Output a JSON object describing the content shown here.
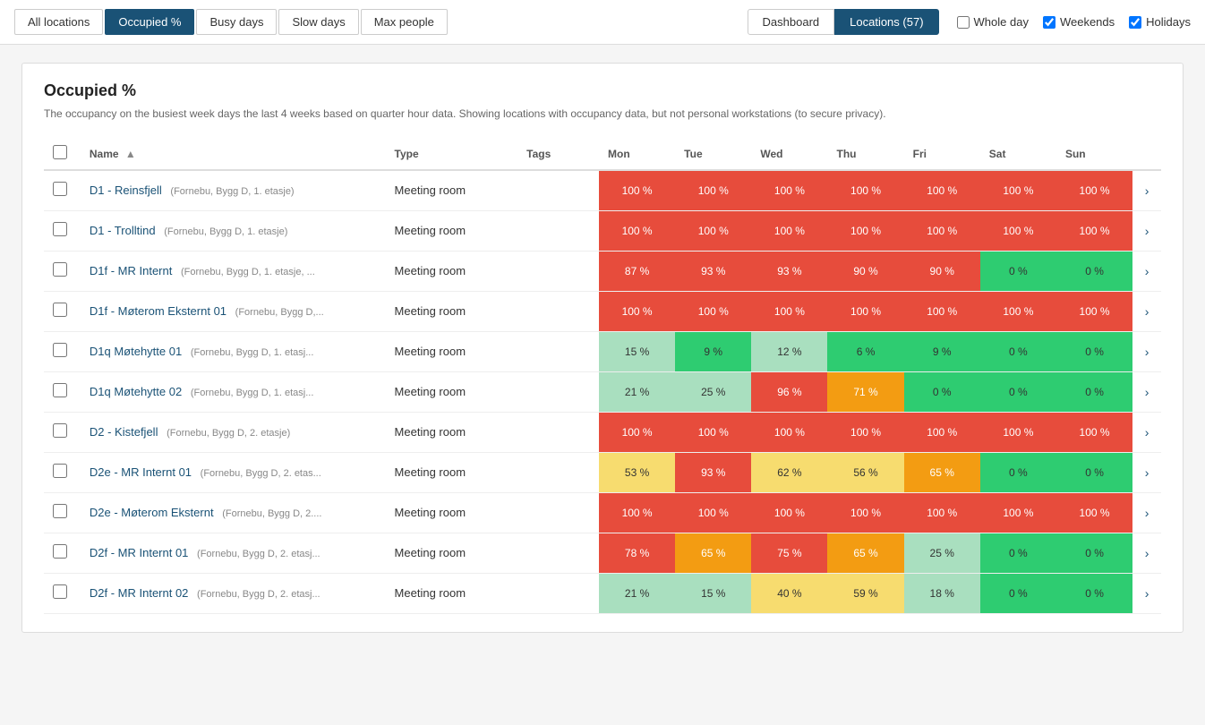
{
  "topbar": {
    "nav_buttons": [
      {
        "label": "All locations",
        "active": false
      },
      {
        "label": "Occupied %",
        "active": true
      },
      {
        "label": "Busy days",
        "active": false
      },
      {
        "label": "Slow days",
        "active": false
      },
      {
        "label": "Max people",
        "active": false
      }
    ],
    "view_buttons": [
      {
        "label": "Dashboard",
        "active": false
      },
      {
        "label": "Locations (57)",
        "active": true
      }
    ],
    "checkboxes": [
      {
        "label": "Whole day",
        "checked": false
      },
      {
        "label": "Weekends",
        "checked": true
      },
      {
        "label": "Holidays",
        "checked": true
      }
    ]
  },
  "card": {
    "title": "Occupied %",
    "subtitle": "The occupancy on the busiest week days the last 4 weeks based on quarter hour data. Showing locations with occupancy data, but not personal workstations (to secure privacy)."
  },
  "table": {
    "headers": [
      "",
      "Name",
      "Type",
      "Tags",
      "Mon",
      "Tue",
      "Wed",
      "Thu",
      "Fri",
      "Sat",
      "Sun",
      ""
    ],
    "rows": [
      {
        "name": "D1 - Reinsfjell",
        "sub": "(Fornebu, Bygg D, 1. etasje)",
        "type": "Meeting room",
        "tags": "",
        "mon": "100 %",
        "tue": "100 %",
        "wed": "100 %",
        "thu": "100 %",
        "fri": "100 %",
        "sat": "100 %",
        "sun": "100 %",
        "mon_c": "c-red",
        "tue_c": "c-red",
        "wed_c": "c-red",
        "thu_c": "c-red",
        "fri_c": "c-red",
        "sat_c": "c-red",
        "sun_c": "c-red"
      },
      {
        "name": "D1 - Trolltind",
        "sub": "(Fornebu, Bygg D, 1. etasje)",
        "type": "Meeting room",
        "tags": "",
        "mon": "100 %",
        "tue": "100 %",
        "wed": "100 %",
        "thu": "100 %",
        "fri": "100 %",
        "sat": "100 %",
        "sun": "100 %",
        "mon_c": "c-red",
        "tue_c": "c-red",
        "wed_c": "c-red",
        "thu_c": "c-red",
        "fri_c": "c-red",
        "sat_c": "c-red",
        "sun_c": "c-red"
      },
      {
        "name": "D1f - MR Internt",
        "sub": "(Fornebu, Bygg D, 1. etasje, ...",
        "type": "Meeting room",
        "tags": "",
        "mon": "87 %",
        "tue": "93 %",
        "wed": "93 %",
        "thu": "90 %",
        "fri": "90 %",
        "sat": "0 %",
        "sun": "0 %",
        "mon_c": "c-red",
        "tue_c": "c-red",
        "wed_c": "c-red",
        "thu_c": "c-red",
        "fri_c": "c-red",
        "sat_c": "c-bright-green",
        "sun_c": "c-bright-green"
      },
      {
        "name": "D1f - Møterom Eksternt 01",
        "sub": "(Fornebu, Bygg D,...",
        "type": "Meeting room",
        "tags": "",
        "mon": "100 %",
        "tue": "100 %",
        "wed": "100 %",
        "thu": "100 %",
        "fri": "100 %",
        "sat": "100 %",
        "sun": "100 %",
        "mon_c": "c-red",
        "tue_c": "c-red",
        "wed_c": "c-red",
        "thu_c": "c-red",
        "fri_c": "c-red",
        "sat_c": "c-red",
        "sun_c": "c-red"
      },
      {
        "name": "D1q Møtehytte 01",
        "sub": "(Fornebu, Bygg D, 1. etasj...",
        "type": "Meeting room",
        "tags": "",
        "mon": "15 %",
        "tue": "9 %",
        "wed": "12 %",
        "thu": "6 %",
        "fri": "9 %",
        "sat": "0 %",
        "sun": "0 %",
        "mon_c": "c-light-green",
        "tue_c": "c-bright-green",
        "wed_c": "c-light-green",
        "thu_c": "c-bright-green",
        "fri_c": "c-bright-green",
        "sat_c": "c-bright-green",
        "sun_c": "c-bright-green"
      },
      {
        "name": "D1q Møtehytte 02",
        "sub": "(Fornebu, Bygg D, 1. etasj...",
        "type": "Meeting room",
        "tags": "",
        "mon": "21 %",
        "tue": "25 %",
        "wed": "96 %",
        "thu": "71 %",
        "fri": "0 %",
        "sat": "0 %",
        "sun": "0 %",
        "mon_c": "c-light-green",
        "tue_c": "c-light-green",
        "wed_c": "c-red",
        "thu_c": "c-orange",
        "fri_c": "c-bright-green",
        "sat_c": "c-bright-green",
        "sun_c": "c-bright-green"
      },
      {
        "name": "D2 - Kistefjell",
        "sub": "(Fornebu, Bygg D, 2. etasje)",
        "type": "Meeting room",
        "tags": "",
        "mon": "100 %",
        "tue": "100 %",
        "wed": "100 %",
        "thu": "100 %",
        "fri": "100 %",
        "sat": "100 %",
        "sun": "100 %",
        "mon_c": "c-red",
        "tue_c": "c-red",
        "wed_c": "c-red",
        "thu_c": "c-red",
        "fri_c": "c-red",
        "sat_c": "c-red",
        "sun_c": "c-red"
      },
      {
        "name": "D2e - MR Internt 01",
        "sub": "(Fornebu, Bygg D, 2. etas...",
        "type": "Meeting room",
        "tags": "",
        "mon": "53 %",
        "tue": "93 %",
        "wed": "62 %",
        "thu": "56 %",
        "fri": "65 %",
        "sat": "0 %",
        "sun": "0 %",
        "mon_c": "c-yellow",
        "tue_c": "c-red",
        "wed_c": "c-yellow",
        "thu_c": "c-yellow",
        "fri_c": "c-orange",
        "sat_c": "c-bright-green",
        "sun_c": "c-bright-green"
      },
      {
        "name": "D2e - Møterom Eksternt",
        "sub": "(Fornebu, Bygg D, 2....",
        "type": "Meeting room",
        "tags": "",
        "mon": "100 %",
        "tue": "100 %",
        "wed": "100 %",
        "thu": "100 %",
        "fri": "100 %",
        "sat": "100 %",
        "sun": "100 %",
        "mon_c": "c-red",
        "tue_c": "c-red",
        "wed_c": "c-red",
        "thu_c": "c-red",
        "fri_c": "c-red",
        "sat_c": "c-red",
        "sun_c": "c-red"
      },
      {
        "name": "D2f - MR Internt 01",
        "sub": "(Fornebu, Bygg D, 2. etasj...",
        "type": "Meeting room",
        "tags": "",
        "mon": "78 %",
        "tue": "65 %",
        "wed": "75 %",
        "thu": "65 %",
        "fri": "25 %",
        "sat": "0 %",
        "sun": "0 %",
        "mon_c": "c-red",
        "tue_c": "c-orange",
        "wed_c": "c-red",
        "thu_c": "c-orange",
        "fri_c": "c-light-green",
        "sat_c": "c-bright-green",
        "sun_c": "c-bright-green"
      },
      {
        "name": "D2f - MR Internt 02",
        "sub": "(Fornebu, Bygg D, 2. etasj...",
        "type": "Meeting room",
        "tags": "",
        "mon": "21 %",
        "tue": "15 %",
        "wed": "40 %",
        "thu": "59 %",
        "fri": "18 %",
        "sat": "0 %",
        "sun": "0 %",
        "mon_c": "c-light-green",
        "tue_c": "c-light-green",
        "wed_c": "c-yellow",
        "thu_c": "c-yellow",
        "fri_c": "c-light-green",
        "sat_c": "c-bright-green",
        "sun_c": "c-bright-green"
      }
    ]
  }
}
